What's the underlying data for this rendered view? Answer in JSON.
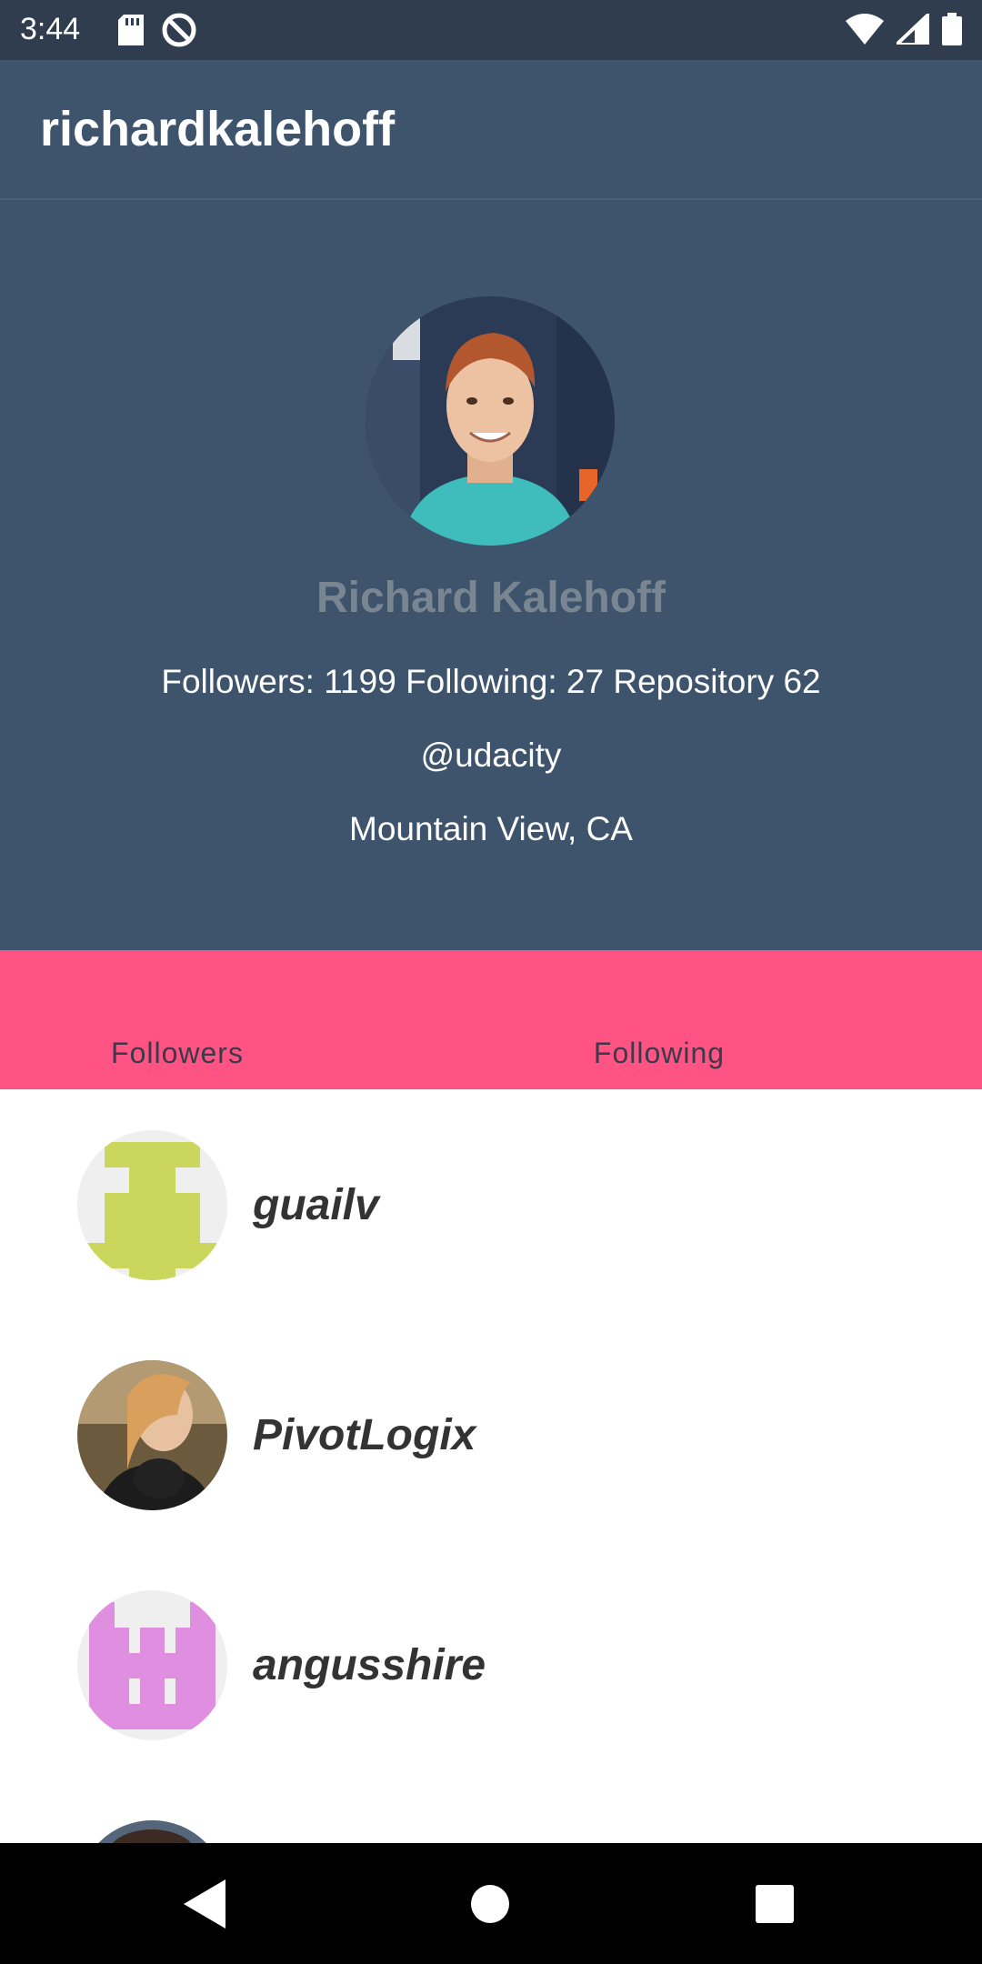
{
  "status_bar": {
    "time": "3:44",
    "icons": [
      "sd-card-icon",
      "no-disturb-icon",
      "wifi-icon",
      "signal-icon",
      "battery-icon"
    ]
  },
  "app_bar": {
    "title": "richardkalehoff"
  },
  "profile": {
    "name": "Richard Kalehoff",
    "stats": "Followers: 1199 Following: 27 Repository 62",
    "company": "@udacity",
    "location": "Mountain View, CA"
  },
  "tabs": [
    {
      "label": "Followers"
    },
    {
      "label": "Following"
    }
  ],
  "followers": [
    {
      "username": "guailv"
    },
    {
      "username": "PivotLogix"
    },
    {
      "username": "angusshire"
    }
  ],
  "colors": {
    "status_bar": "#2f3d4e",
    "primary": "#3e536c",
    "tab_accent": "#ff5383",
    "identicon_green": "#cbd65c",
    "identicon_pink": "#e08fe0"
  }
}
